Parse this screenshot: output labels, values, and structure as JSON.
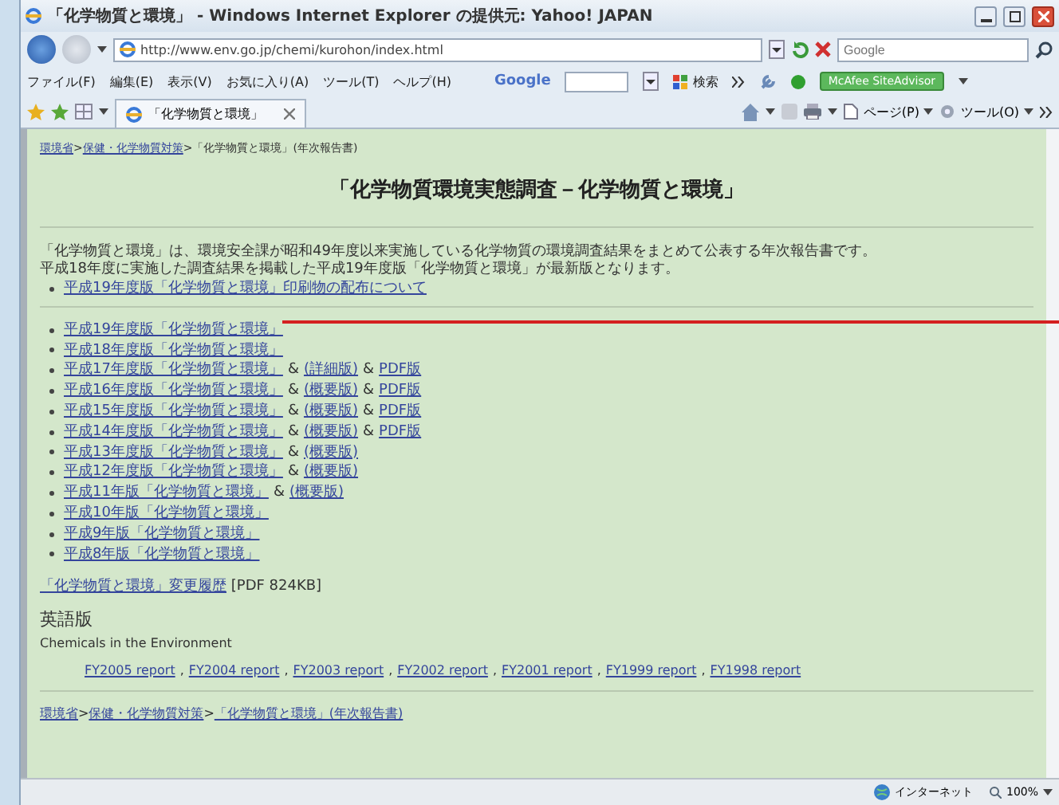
{
  "window": {
    "title": "「化学物質と環境」 - Windows Internet Explorer の提供元: Yahoo! JAPAN"
  },
  "address_bar": {
    "url": "http://www.env.go.jp/chemi/kurohon/index.html",
    "search_placeholder": "Google"
  },
  "menu_bar": [
    "ファイル(F)",
    "編集(E)",
    "表示(V)",
    "お気に入り(A)",
    "ツール(T)",
    "ヘルプ(H)"
  ],
  "google_toolbar": {
    "logo": "Google",
    "search_label": "検索",
    "addon": "McAfee SiteAdvisor"
  },
  "tab": {
    "title": "「化学物質と環境」",
    "selected": true
  },
  "command_bar": [
    "ページ(P)",
    "ツール(O)"
  ],
  "page": {
    "breadcrumb": [
      {
        "text": "環境省",
        "kind": "link"
      },
      {
        "text": ">",
        "kind": "text"
      },
      {
        "text": "保健・化学物質対策",
        "kind": "link"
      },
      {
        "text": ">「化学物質と環境」(年次報告書)",
        "kind": "text"
      }
    ],
    "heading": "「化学物質環境実態調査－化学物質と環境」",
    "intro": [
      "「化学物質と環境」は、環境安全課が昭和49年度以来実施している化学物質の環境調査結果をまとめて公表する年次報告書です。",
      "平成18年度に実施した調査結果を掲載した平成19年度版「化学物質と環境」が最新版となります。"
    ],
    "notice_links": [
      "平成19年度版「化学物質と環境」印刷物の配布について"
    ],
    "editions": [
      [
        {
          "text": "平成19年度版「化学物質と環境」",
          "kind": "link"
        }
      ],
      [
        {
          "text": "平成18年度版「化学物質と環境」",
          "kind": "link"
        }
      ],
      [
        {
          "text": "平成17年度版「化学物質と環境」",
          "kind": "link"
        },
        {
          "text": "&",
          "kind": "text"
        },
        {
          "text": "(詳細版)",
          "kind": "link"
        },
        {
          "text": "&",
          "kind": "text"
        },
        {
          "text": "PDF版",
          "kind": "link"
        }
      ],
      [
        {
          "text": "平成16年度版「化学物質と環境」",
          "kind": "link"
        },
        {
          "text": "&",
          "kind": "text"
        },
        {
          "text": "(概要版)",
          "kind": "link"
        },
        {
          "text": "&",
          "kind": "text"
        },
        {
          "text": "PDF版",
          "kind": "link"
        }
      ],
      [
        {
          "text": "平成15年度版「化学物質と環境」",
          "kind": "link"
        },
        {
          "text": "&",
          "kind": "text"
        },
        {
          "text": "(概要版)",
          "kind": "link"
        },
        {
          "text": "&",
          "kind": "text"
        },
        {
          "text": "PDF版",
          "kind": "link"
        }
      ],
      [
        {
          "text": "平成14年度版「化学物質と環境」",
          "kind": "link"
        },
        {
          "text": "&",
          "kind": "text"
        },
        {
          "text": "(概要版)",
          "kind": "link"
        },
        {
          "text": "&",
          "kind": "text"
        },
        {
          "text": "PDF版",
          "kind": "link"
        }
      ],
      [
        {
          "text": "平成13年度版「化学物質と環境」",
          "kind": "link"
        },
        {
          "text": "&",
          "kind": "text"
        },
        {
          "text": "(概要版)",
          "kind": "link"
        }
      ],
      [
        {
          "text": "平成12年度版「化学物質と環境」",
          "kind": "link"
        },
        {
          "text": "&",
          "kind": "text"
        },
        {
          "text": "(概要版)",
          "kind": "link"
        }
      ],
      [
        {
          "text": "平成11年版「化学物質と環境」",
          "kind": "link"
        },
        {
          "text": "&",
          "kind": "text"
        },
        {
          "text": "(概要版)",
          "kind": "link"
        }
      ],
      [
        {
          "text": "平成10年版「化学物質と環境」",
          "kind": "link"
        }
      ],
      [
        {
          "text": "平成9年版「化学物質と環境」",
          "kind": "link"
        }
      ],
      [
        {
          "text": "平成8年版「化学物質と環境」",
          "kind": "link"
        }
      ]
    ],
    "history": [
      {
        "text": "「化学物質と環境」変更履歴",
        "kind": "link"
      },
      {
        "text": "[PDF 824KB]",
        "kind": "text"
      }
    ],
    "english_heading": "英語版",
    "english_title": "Chemicals in the Environment",
    "english_reports": [
      {
        "text": "FY2005 report",
        "kind": "link"
      },
      {
        "text": ",",
        "kind": "text"
      },
      {
        "text": "FY2004 report",
        "kind": "link"
      },
      {
        "text": ",",
        "kind": "text"
      },
      {
        "text": "FY2003 report",
        "kind": "link"
      },
      {
        "text": ",",
        "kind": "text"
      },
      {
        "text": "FY2002 report",
        "kind": "link"
      },
      {
        "text": ",",
        "kind": "text"
      },
      {
        "text": "FY2001 report",
        "kind": "link"
      },
      {
        "text": ",",
        "kind": "text"
      },
      {
        "text": "FY1999 report",
        "kind": "link"
      },
      {
        "text": ",",
        "kind": "text"
      },
      {
        "text": "FY1998 report",
        "kind": "link"
      }
    ],
    "footer_breadcrumb": [
      {
        "text": "環境省",
        "kind": "link"
      },
      {
        "text": ">",
        "kind": "text"
      },
      {
        "text": "保健・化学物質対策",
        "kind": "link"
      },
      {
        "text": ">",
        "kind": "text"
      },
      {
        "text": "「化学物質と環境」(年次報告書)",
        "kind": "link"
      }
    ]
  },
  "status_bar": {
    "zone": "インターネット",
    "zoom": "100%"
  }
}
